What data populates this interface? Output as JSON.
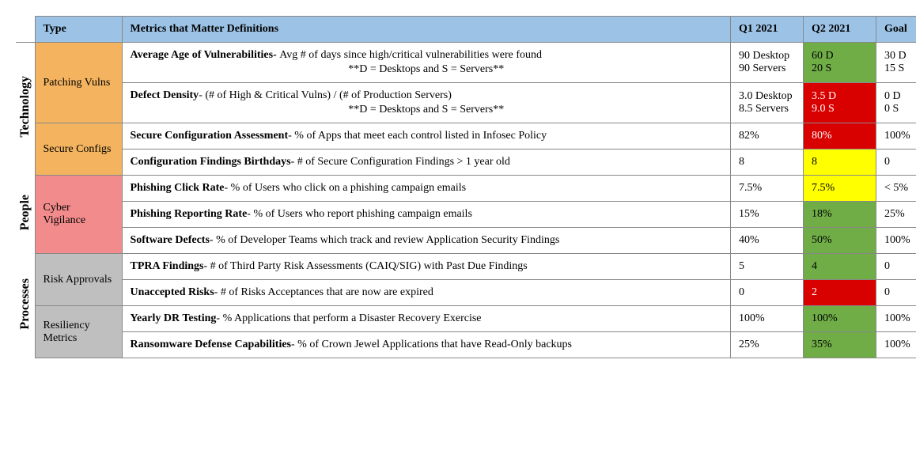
{
  "headers": {
    "type": "Type",
    "metrics": "Metrics that Matter Definitions",
    "q1": "Q1 2021",
    "q2": "Q2 2021",
    "goal": "Goal"
  },
  "vlabels": {
    "technology": "Technology",
    "people": "People",
    "processes": "Processes"
  },
  "types": {
    "patching": "Patching Vulns",
    "secure": "Secure Configs",
    "cyber": "Cyber Vigilance",
    "risk": "Risk Approvals",
    "resiliency": "Resiliency Metrics"
  },
  "rows": {
    "r1": {
      "title": "Average Age of Vulnerabilities- ",
      "desc": "Avg # of days since high/critical vulnerabilities were found",
      "note": "**D = Desktops  and S = Servers**",
      "q1": "90 Desktop\n90 Servers",
      "q2": "60 D\n20 S",
      "goal": "30 D\n15 S"
    },
    "r2": {
      "title": "Defect Density",
      "desc": "- (# of High & Critical Vulns) / (# of Production Servers)",
      "note": "**D = Desktops  and S = Servers**",
      "q1": "3.0 Desktop\n8.5 Servers",
      "q2": "3.5 D\n9.0 S",
      "goal": "0 D\n0 S"
    },
    "r3": {
      "title": "Secure Configuration Assessment",
      "desc": "- % of Apps that meet each control listed in Infosec Policy",
      "q1": "82%",
      "q2": "80%",
      "goal": "100%"
    },
    "r4": {
      "title": "Configuration Findings Birthdays",
      "desc": "- # of Secure Configuration Findings > 1 year old",
      "q1": "8",
      "q2": "8",
      "goal": "0"
    },
    "r5": {
      "title": "Phishing Click Rate",
      "desc": "- % of Users who click on a phishing campaign emails",
      "q1": "7.5%",
      "q2": "7.5%",
      "goal": "< 5%"
    },
    "r6": {
      "title": "Phishing Reporting Rate",
      "desc": "- % of Users who report phishing campaign emails",
      "q1": "15%",
      "q2": "18%",
      "goal": "25%"
    },
    "r7": {
      "title": "Software Defects",
      "desc": "- % of Developer Teams which track and review Application Security Findings",
      "q1": "40%",
      "q2": "50%",
      "goal": "100%"
    },
    "r8": {
      "title": "TPRA Findings",
      "desc": "- # of Third Party Risk Assessments (CAIQ/SIG) with Past Due Findings",
      "q1": "5",
      "q2": "4",
      "goal": "0"
    },
    "r9": {
      "title": "Unaccepted Risks",
      "desc": "- # of Risks Acceptances that are now are expired",
      "q1": "0",
      "q2": "2",
      "goal": "0"
    },
    "r10": {
      "title": "Yearly DR Testing",
      "desc": "- % Applications that perform a Disaster Recovery Exercise",
      "q1": "100%",
      "q2": "100%",
      "goal": "100%"
    },
    "r11": {
      "title": "Ransomware Defense Capabilities",
      "desc": "- % of Crown Jewel Applications that have Read-Only backups",
      "q1": "25%",
      "q2": "35%",
      "goal": "100%"
    }
  }
}
